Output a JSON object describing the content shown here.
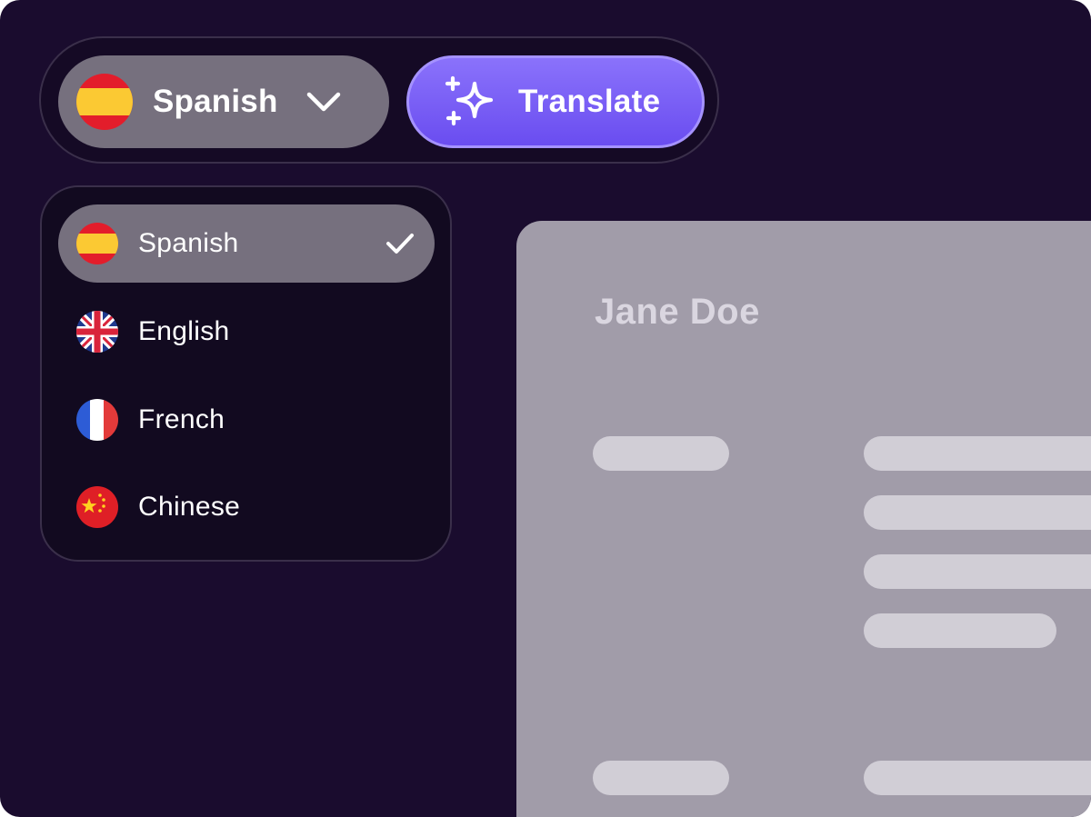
{
  "toolbar": {
    "selected_language": "Spanish",
    "translate_label": "Translate"
  },
  "dropdown": {
    "options": [
      {
        "label": "Spanish",
        "flag": "spain-flag-icon",
        "selected": true
      },
      {
        "label": "English",
        "flag": "uk-flag-icon",
        "selected": false
      },
      {
        "label": "French",
        "flag": "france-flag-icon",
        "selected": false
      },
      {
        "label": "Chinese",
        "flag": "china-flag-icon",
        "selected": false
      }
    ]
  },
  "document": {
    "title": "Jane Doe"
  },
  "colors": {
    "background": "#1a0c2e",
    "accent": "#7358f5",
    "selected": "#76707e",
    "document": "#a19ca9"
  },
  "icons": [
    "spain-flag-icon",
    "uk-flag-icon",
    "france-flag-icon",
    "china-flag-icon",
    "chevron-down-icon",
    "sparkle-icon",
    "check-icon"
  ]
}
